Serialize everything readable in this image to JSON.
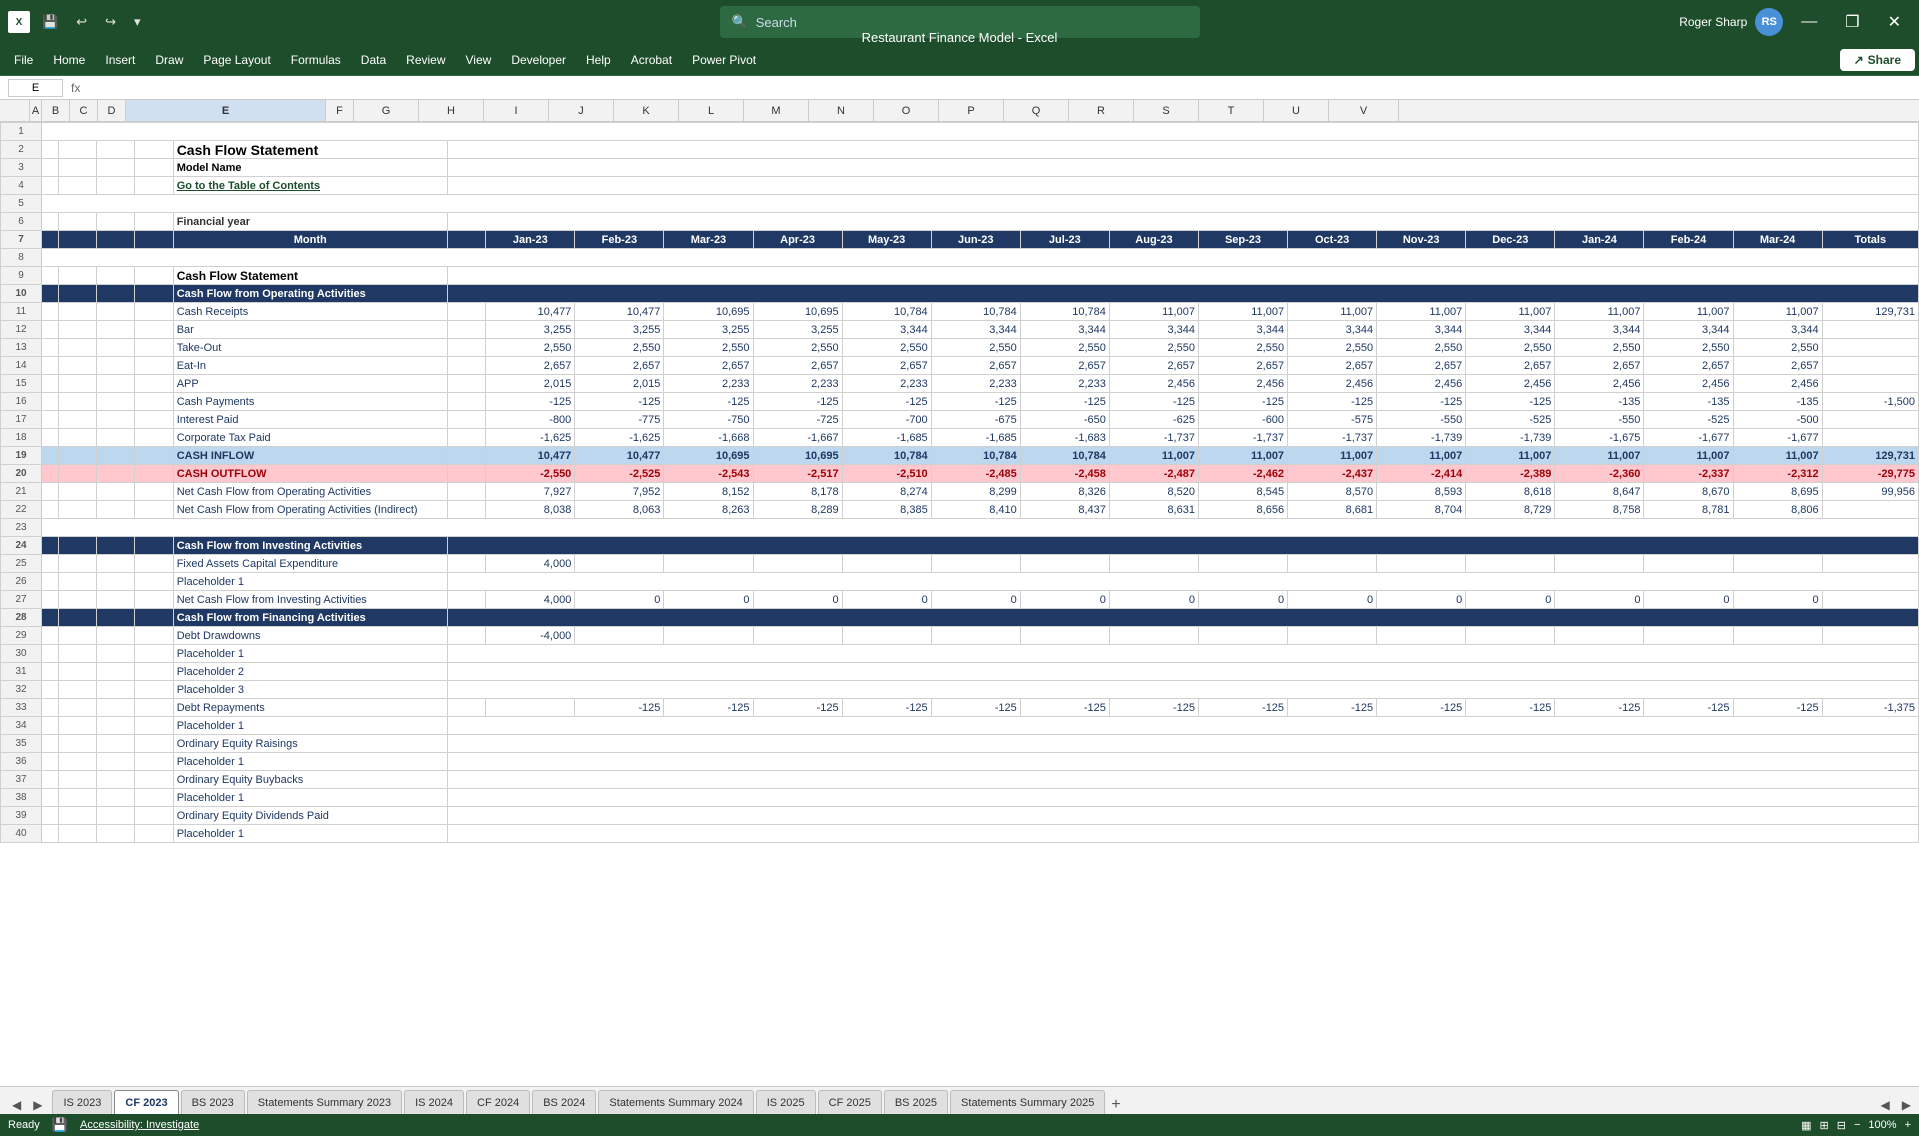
{
  "titlebar": {
    "app_name": "Restaurant Finance Model  -  Excel",
    "search_placeholder": "Search",
    "user_name": "Roger Sharp",
    "user_initials": "RS",
    "minimize": "—",
    "restore": "❐",
    "close": "✕"
  },
  "menubar": {
    "items": [
      "File",
      "Home",
      "Insert",
      "Draw",
      "Page Layout",
      "Formulas",
      "Data",
      "Review",
      "View",
      "Developer",
      "Help",
      "Acrobat",
      "Power Pivot"
    ],
    "share_label": "Share"
  },
  "formulabar": {
    "cell_ref": "E",
    "formula": ""
  },
  "columns": {
    "row_num": "#",
    "letters": [
      "A",
      "B",
      "C",
      "D",
      "E",
      "F",
      "G",
      "H",
      "I",
      "J",
      "K",
      "L",
      "M",
      "N",
      "O",
      "P",
      "Q",
      "R",
      "S",
      "T",
      "U",
      "V"
    ]
  },
  "spreadsheet": {
    "title": "Cash Flow Statement",
    "model_name": "Model Name",
    "goto_toc": "Go to the Table of Contents",
    "financial_year_label": "Financial year",
    "header_month": "Month",
    "header_cols": [
      "Jan-23",
      "Feb-23",
      "Mar-23",
      "Apr-23",
      "May-23",
      "Jun-23",
      "Jul-23",
      "Aug-23",
      "Sep-23",
      "Oct-23",
      "Nov-23",
      "Dec-23",
      "Jan-24",
      "Feb-24",
      "Mar-24",
      "Totals"
    ],
    "section_operating": "Cash Flow from Operating Activities",
    "rows": [
      {
        "label": "Cash Receipts",
        "indent": 1,
        "vals": [
          10477,
          10477,
          10695,
          10695,
          10784,
          10784,
          10784,
          11007,
          11007,
          11007,
          11007,
          11007,
          11007,
          11007,
          11007,
          129731
        ]
      },
      {
        "label": "Bar",
        "indent": 2,
        "vals": [
          3255,
          3255,
          3255,
          3255,
          3344,
          3344,
          3344,
          3344,
          3344,
          3344,
          3344,
          3344,
          3344,
          3344,
          3344,
          ""
        ]
      },
      {
        "label": "Take-Out",
        "indent": 2,
        "vals": [
          2550,
          2550,
          2550,
          2550,
          2550,
          2550,
          2550,
          2550,
          2550,
          2550,
          2550,
          2550,
          2550,
          2550,
          2550,
          ""
        ]
      },
      {
        "label": "Eat-In",
        "indent": 2,
        "vals": [
          2657,
          2657,
          2657,
          2657,
          2657,
          2657,
          2657,
          2657,
          2657,
          2657,
          2657,
          2657,
          2657,
          2657,
          2657,
          ""
        ]
      },
      {
        "label": "APP",
        "indent": 2,
        "vals": [
          2015,
          2015,
          2233,
          2233,
          2233,
          2233,
          2233,
          2456,
          2456,
          2456,
          2456,
          2456,
          2456,
          2456,
          2456,
          ""
        ]
      },
      {
        "label": "Cash Payments",
        "indent": 1,
        "vals": [
          -125,
          -125,
          -125,
          -125,
          -125,
          -125,
          -125,
          -125,
          -125,
          -125,
          -125,
          -125,
          -135,
          -135,
          -135,
          -1500
        ]
      },
      {
        "label": "Interest Paid",
        "indent": 1,
        "vals": [
          -800,
          -775,
          -750,
          -725,
          -700,
          -675,
          -650,
          -625,
          -600,
          -575,
          -550,
          -525,
          -550,
          -525,
          -500,
          ""
        ]
      },
      {
        "label": "Corporate Tax Paid",
        "indent": 1,
        "vals": [
          -1625,
          -1625,
          -1668,
          -1667,
          -1685,
          -1685,
          -1683,
          -1737,
          -1737,
          -1737,
          -1739,
          -1739,
          -1675,
          -1677,
          -1677,
          ""
        ]
      },
      {
        "label": "CASH INFLOW",
        "indent": 0,
        "type": "inflow",
        "vals": [
          10477,
          10477,
          10695,
          10695,
          10784,
          10784,
          10784,
          11007,
          11007,
          11007,
          11007,
          11007,
          11007,
          11007,
          11007,
          129731
        ]
      },
      {
        "label": "CASH OUTFLOW",
        "indent": 0,
        "type": "outflow",
        "vals": [
          -2550,
          -2525,
          -2543,
          -2517,
          -2510,
          -2485,
          -2458,
          -2487,
          -2462,
          -2437,
          -2414,
          -2389,
          -2360,
          -2337,
          -2312,
          -29775
        ]
      },
      {
        "label": "Net Cash Flow from Operating Activities",
        "indent": 1,
        "type": "net",
        "vals": [
          7927,
          7952,
          8152,
          8178,
          8274,
          8299,
          8326,
          8520,
          8545,
          8570,
          8593,
          8618,
          8647,
          8670,
          8695,
          99956
        ]
      },
      {
        "label": "Net Cash Flow from Operating Activities (Indirect)",
        "indent": 1,
        "type": "net",
        "vals": [
          8038,
          8063,
          8263,
          8289,
          8385,
          8410,
          8437,
          8631,
          8656,
          8681,
          8704,
          8729,
          8758,
          8781,
          8806,
          ""
        ]
      }
    ],
    "section_investing": "Cash Flow from Investing Activities",
    "investing_rows": [
      {
        "label": "Fixed Assets Capital Expenditure",
        "indent": 1,
        "vals": [
          4000,
          "",
          "",
          "",
          "",
          "",
          "",
          "",
          "",
          "",
          "",
          "",
          "",
          "",
          "",
          ""
        ]
      },
      {
        "label": "Placeholder 1",
        "indent": 2,
        "vals": [
          "",
          "",
          "",
          "",
          "",
          "",
          "",
          "",
          "",
          "",
          "",
          "",
          "",
          "",
          "",
          ""
        ]
      },
      {
        "label": "Net Cash Flow from Investing Activities",
        "indent": 1,
        "type": "net",
        "vals": [
          4000,
          0,
          0,
          0,
          0,
          0,
          0,
          0,
          0,
          0,
          0,
          0,
          0,
          0,
          0,
          ""
        ]
      }
    ],
    "section_financing": "Cash Flow from Financing Activities",
    "financing_rows": [
      {
        "label": "Debt Drawdowns",
        "indent": 1,
        "vals": [
          -4000,
          "",
          "",
          "",
          "",
          "",
          "",
          "",
          "",
          "",
          "",
          "",
          "",
          "",
          "",
          ""
        ]
      },
      {
        "label": "Placeholder 1",
        "indent": 2,
        "vals": [
          "",
          "",
          "",
          "",
          "",
          "",
          "",
          "",
          "",
          "",
          "",
          "",
          "",
          "",
          "",
          ""
        ]
      },
      {
        "label": "Placeholder 2",
        "indent": 2,
        "vals": [
          "",
          "",
          "",
          "",
          "",
          "",
          "",
          "",
          "",
          "",
          "",
          "",
          "",
          "",
          "",
          ""
        ]
      },
      {
        "label": "Placeholder 3",
        "indent": 2,
        "vals": [
          "",
          "",
          "",
          "",
          "",
          "",
          "",
          "",
          "",
          "",
          "",
          "",
          "",
          "",
          "",
          ""
        ]
      },
      {
        "label": "Debt Repayments",
        "indent": 1,
        "vals": [
          "",
          -125,
          -125,
          -125,
          -125,
          -125,
          -125,
          -125,
          -125,
          -125,
          -125,
          -125,
          -125,
          -125,
          -125,
          -1375
        ]
      },
      {
        "label": "Placeholder 1",
        "indent": 2,
        "vals": [
          "",
          "",
          "",
          "",
          "",
          "",
          "",
          "",
          "",
          "",
          "",
          "",
          "",
          "",
          "",
          ""
        ]
      },
      {
        "label": "Ordinary Equity Raisings",
        "indent": 1,
        "vals": [
          "",
          "",
          "",
          "",
          "",
          "",
          "",
          "",
          "",
          "",
          "",
          "",
          "",
          "",
          "",
          ""
        ]
      },
      {
        "label": "Placeholder 1",
        "indent": 2,
        "vals": [
          "",
          "",
          "",
          "",
          "",
          "",
          "",
          "",
          "",
          "",
          "",
          "",
          "",
          "",
          "",
          ""
        ]
      },
      {
        "label": "Ordinary Equity Buybacks",
        "indent": 1,
        "vals": [
          "",
          "",
          "",
          "",
          "",
          "",
          "",
          "",
          "",
          "",
          "",
          "",
          "",
          "",
          "",
          ""
        ]
      },
      {
        "label": "Placeholder 1",
        "indent": 2,
        "vals": [
          "",
          "",
          "",
          "",
          "",
          "",
          "",
          "",
          "",
          "",
          "",
          "",
          "",
          "",
          "",
          ""
        ]
      },
      {
        "label": "Ordinary Equity Dividends Paid",
        "indent": 1,
        "vals": [
          "",
          "",
          "",
          "",
          "",
          "",
          "",
          "",
          "",
          "",
          "",
          "",
          "",
          "",
          "",
          ""
        ]
      },
      {
        "label": "Placeholder 1",
        "indent": 2,
        "vals": [
          "",
          "",
          "",
          "",
          "",
          "",
          "",
          "",
          "",
          "",
          "",
          "",
          "",
          "",
          "",
          ""
        ]
      }
    ]
  },
  "tabs": [
    {
      "label": "IS 2023",
      "active": false
    },
    {
      "label": "CF 2023",
      "active": true
    },
    {
      "label": "BS 2023",
      "active": false
    },
    {
      "label": "Statements Summary 2023",
      "active": false
    },
    {
      "label": "IS 2024",
      "active": false
    },
    {
      "label": "CF 2024",
      "active": false
    },
    {
      "label": "BS 2024",
      "active": false
    },
    {
      "label": "Statements Summary 2024",
      "active": false
    },
    {
      "label": "IS 2025",
      "active": false
    },
    {
      "label": "CF 2025",
      "active": false
    },
    {
      "label": "BS 2025",
      "active": false
    },
    {
      "label": "Statements Summary 2025",
      "active": false
    }
  ],
  "statusbar": {
    "ready": "Ready",
    "accessibility": "Accessibility: Investigate",
    "zoom": "100%"
  }
}
